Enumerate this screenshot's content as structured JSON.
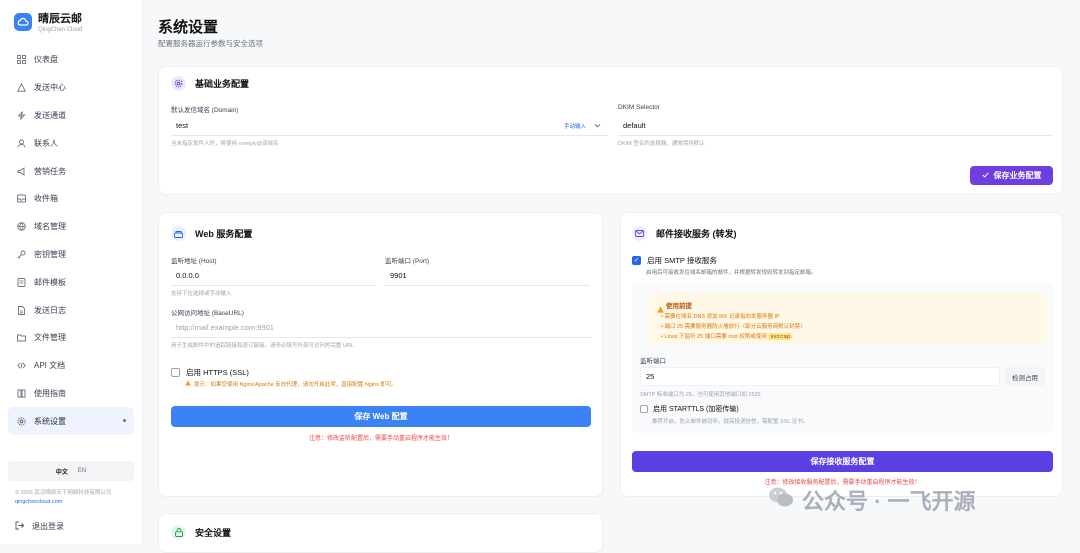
{
  "brand": {
    "name": "晴辰云邮",
    "sub": "QingChen Cloud"
  },
  "nav": [
    {
      "label": "仪表盘",
      "icon": "grid-icon"
    },
    {
      "label": "发送中心",
      "icon": "send-icon"
    },
    {
      "label": "发送通道",
      "icon": "lightning-icon"
    },
    {
      "label": "联系人",
      "icon": "user-icon"
    },
    {
      "label": "营销任务",
      "icon": "megaphone-icon"
    },
    {
      "label": "收件箱",
      "icon": "inbox-icon"
    },
    {
      "label": "域名管理",
      "icon": "globe-icon"
    },
    {
      "label": "密钥管理",
      "icon": "key-icon"
    },
    {
      "label": "邮件模板",
      "icon": "template-icon"
    },
    {
      "label": "发送日志",
      "icon": "log-icon"
    },
    {
      "label": "文件管理",
      "icon": "folder-icon"
    },
    {
      "label": "API 文档",
      "icon": "code-icon"
    },
    {
      "label": "使用指南",
      "icon": "book-icon"
    },
    {
      "label": "系统设置",
      "icon": "gear-icon"
    }
  ],
  "lang": {
    "zh": "中文",
    "en": "EN"
  },
  "footer": {
    "copyright": "© 2026 武汉晴辰天下网络科技有限公司",
    "site": "qingchencloud.com",
    "logout": "退出登录"
  },
  "page": {
    "title": "系统设置",
    "subtitle": "配置服务器运行参数与安全选项"
  },
  "biz": {
    "title": "基础业务配置",
    "domain_label": "默认发信域名 (Domain)",
    "domain_value": "test",
    "manual_input": "手动输入",
    "domain_hint": "当未指定发件人时，将使用 noreply@该域名",
    "dkim_label": "DKIM Selector",
    "dkim_value": "default",
    "dkim_hint": "DKIM 签名的选择器，通常保持默认",
    "save": "保存业务配置"
  },
  "web": {
    "title": "Web 服务配置",
    "host_label": "监听地址 (Host)",
    "host_value": "0.0.0.0",
    "host_hint": "支持下拉选择或手动输入",
    "port_label": "监听端口 (Port)",
    "port_value": "9901",
    "base_label": "公网访问地址 (BaseURL)",
    "base_placeholder": "http://mail.example.com:9901",
    "base_hint": "用于生成邮件中的追踪链接和退订链接。请务必填写外部可访问的完整 URL",
    "https_label": "启用 HTTPS (SSL)",
    "https_hint": "提示：如果您使用 Nginx/Apache 反向代理，请勿开启此项，直接配置 Nginx 即可。",
    "save": "保存 Web 配置",
    "note": "注意：修改监听配置后，需要手动重启程序才能生效！"
  },
  "recv": {
    "title": "邮件接收服务 (转发)",
    "smtp_label": "启用 SMTP 接收服务",
    "smtp_hint": "启用后可接收发往域名邮箱的邮件，并根据转发规则转发到指定邮箱。",
    "tip_title": "使用前提",
    "tips": [
      "需要在域名 DNS 添加 MX 记录指向本服务器 IP",
      "端口 25 需要服务器防火墙放行（部分云服务商默认封禁）",
      "Linux 下监听 25 端口需要 root 权限或使用"
    ],
    "tip_code": "setcap",
    "port_label": "监听端口",
    "port_value": "25",
    "detect": "检测占用",
    "port_hint": "SMTP 标准端口为 25。也可使用其他端口如 2525",
    "starttls_label": "启用 STARTTLS (加密传输)",
    "starttls_hint": "推荐开启，防止邮件被窃听。提高投递信誉，需配置 SSL 证书。",
    "save": "保存接收服务配置",
    "note": "注意：修改接收服务配置后，需要手动重启程序才能生效！"
  },
  "security": {
    "title": "安全设置"
  },
  "watermark": "公众号 · 一飞开源",
  "colors": {
    "primary": "#3b82f6",
    "purple": "#6d3fe0",
    "warn": "#ef4444"
  }
}
